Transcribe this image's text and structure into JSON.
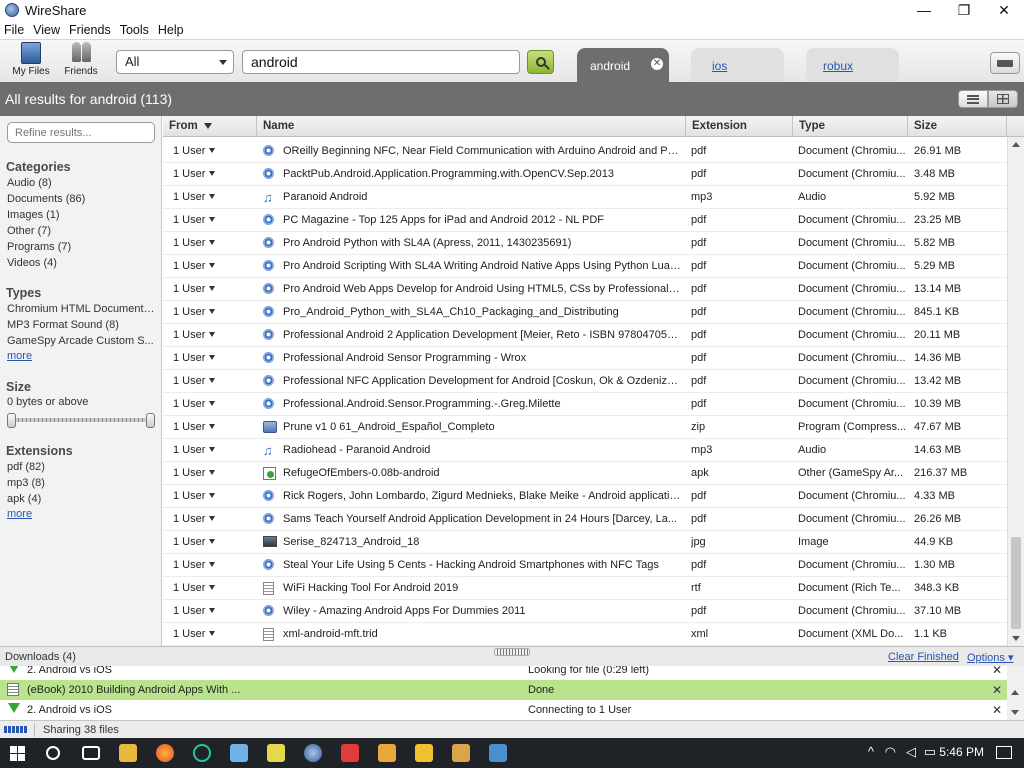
{
  "window": {
    "title": "WireShare",
    "minimize": "—",
    "maximize": "❐",
    "close": "✕"
  },
  "menu": [
    "File",
    "View",
    "Friends",
    "Tools",
    "Help"
  ],
  "toolbar": {
    "my_files_label": "My Files",
    "friends_label": "Friends",
    "filter_value": "All",
    "search_value": "android",
    "tabs": [
      {
        "label": "android",
        "active": true
      },
      {
        "label": "ios",
        "active": false
      },
      {
        "label": "robux",
        "active": false
      }
    ]
  },
  "results": {
    "title": "All results for android (113)"
  },
  "filters": {
    "refine_placeholder": "Refine results...",
    "categories_title": "Categories",
    "categories": [
      "Audio (8)",
      "Documents (86)",
      "Images (1)",
      "Other (7)",
      "Programs (7)",
      "Videos (4)"
    ],
    "types_title": "Types",
    "types": [
      "Chromium HTML Document (...",
      "MP3 Format Sound (8)",
      "GameSpy Arcade Custom S..."
    ],
    "more_label": "more",
    "size_title": "Size",
    "size_range": "0 bytes or above",
    "extensions_title": "Extensions",
    "extensions": [
      "pdf (82)",
      "mp3 (8)",
      "apk (4)"
    ]
  },
  "table": {
    "columns": [
      "From",
      "Name",
      "Extension",
      "Type",
      "Size"
    ],
    "rows": [
      {
        "from": "1 User",
        "icon": "doc",
        "name": "OReilly Beginning NFC, Near Field Communication with Arduino Android and Pho...",
        "ext": "pdf",
        "type": "Document (Chromiu...",
        "size": "26.91 MB"
      },
      {
        "from": "1 User",
        "icon": "doc",
        "name": "PacktPub.Android.Application.Programming.with.OpenCV.Sep.2013",
        "ext": "pdf",
        "type": "Document (Chromiu...",
        "size": "3.48 MB"
      },
      {
        "from": "1 User",
        "icon": "audio",
        "name": "Paranoid Android",
        "ext": "mp3",
        "type": "Audio",
        "size": "5.92 MB"
      },
      {
        "from": "1 User",
        "icon": "doc",
        "name": "PC Magazine - Top 125 Apps for iPad and Android 2012 - NL PDF",
        "ext": "pdf",
        "type": "Document (Chromiu...",
        "size": "23.25 MB"
      },
      {
        "from": "1 User",
        "icon": "doc",
        "name": "Pro Android Python with SL4A (Apress, 2011, 1430235691)",
        "ext": "pdf",
        "type": "Document (Chromiu...",
        "size": "5.82 MB"
      },
      {
        "from": "1 User",
        "icon": "doc",
        "name": "Pro Android Scripting With SL4A Writing Android Native Apps Using Python Lua a...",
        "ext": "pdf",
        "type": "Document (Chromiu...",
        "size": "5.29 MB"
      },
      {
        "from": "1 User",
        "icon": "doc",
        "name": "Pro Android Web Apps Develop for Android Using HTML5, CSs by Professionals...",
        "ext": "pdf",
        "type": "Document (Chromiu...",
        "size": "13.14 MB"
      },
      {
        "from": "1 User",
        "icon": "doc",
        "name": "Pro_Android_Python_with_SL4A_Ch10_Packaging_and_Distributing",
        "ext": "pdf",
        "type": "Document (Chromiu...",
        "size": "845.1 KB"
      },
      {
        "from": "1 User",
        "icon": "doc",
        "name": "Professional Android 2 Application Development [Meier, Reto - ISBN 9780470565...",
        "ext": "pdf",
        "type": "Document (Chromiu...",
        "size": "20.11 MB"
      },
      {
        "from": "1 User",
        "icon": "doc",
        "name": "Professional Android Sensor Programming - Wrox",
        "ext": "pdf",
        "type": "Document (Chromiu...",
        "size": "14.36 MB"
      },
      {
        "from": "1 User",
        "icon": "doc",
        "name": "Professional NFC Application Development for Android [Coskun, Ok & Ozdenizci ...",
        "ext": "pdf",
        "type": "Document (Chromiu...",
        "size": "13.42 MB"
      },
      {
        "from": "1 User",
        "icon": "doc",
        "name": "Professional.Android.Sensor.Programming.-.Greg.Milette",
        "ext": "pdf",
        "type": "Document (Chromiu...",
        "size": "10.39 MB"
      },
      {
        "from": "1 User",
        "icon": "zip",
        "name": "Prune v1 0 61_Android_Español_Completo",
        "ext": "zip",
        "type": "Program (Compress...",
        "size": "47.67 MB"
      },
      {
        "from": "1 User",
        "icon": "audio",
        "name": "Radiohead - Paranoid Android",
        "ext": "mp3",
        "type": "Audio",
        "size": "14.63 MB"
      },
      {
        "from": "1 User",
        "icon": "apk",
        "name": "RefugeOfEmbers-0.08b-android",
        "ext": "apk",
        "type": "Other (GameSpy Ar...",
        "size": "216.37 MB"
      },
      {
        "from": "1 User",
        "icon": "doc",
        "name": "Rick Rogers, John Lombardo, Zigurd Mednieks, Blake Meike - Android application...",
        "ext": "pdf",
        "type": "Document (Chromiu...",
        "size": "4.33 MB"
      },
      {
        "from": "1 User",
        "icon": "doc",
        "name": "Sams Teach Yourself Android Application Development in 24 Hours [Darcey, La...",
        "ext": "pdf",
        "type": "Document (Chromiu...",
        "size": "26.26 MB"
      },
      {
        "from": "1 User",
        "icon": "img",
        "name": "Serise_824713_Android_18",
        "ext": "jpg",
        "type": "Image",
        "size": "44.9 KB"
      },
      {
        "from": "1 User",
        "icon": "doc",
        "name": "Steal Your Life Using 5 Cents - Hacking Android Smartphones with NFC Tags",
        "ext": "pdf",
        "type": "Document (Chromiu...",
        "size": "1.30 MB"
      },
      {
        "from": "1 User",
        "icon": "text",
        "name": "WiFi Hacking Tool For Android 2019",
        "ext": "rtf",
        "type": "Document (Rich Te...",
        "size": "348.3 KB"
      },
      {
        "from": "1 User",
        "icon": "doc",
        "name": "Wiley - Amazing Android Apps For Dummies 2011",
        "ext": "pdf",
        "type": "Document (Chromiu...",
        "size": "37.10 MB"
      },
      {
        "from": "1 User",
        "icon": "text",
        "name": "xml-android-mft.trid",
        "ext": "xml",
        "type": "Document (XML Do...",
        "size": "1.1 KB"
      }
    ]
  },
  "downloads": {
    "title": "Downloads (4)",
    "clear_label": "Clear Finished",
    "options_label": "Options ▾",
    "rows": [
      {
        "icon": "arrow",
        "name": "2. Android vs iOS",
        "status": "Looking for file (0:29 left)",
        "done": false
      },
      {
        "icon": "doc",
        "name": "(eBook) 2010 Building Android Apps With ...",
        "status": "Done",
        "done": true
      },
      {
        "icon": "arrow",
        "name": "2. Android vs iOS",
        "status": "Connecting to 1 User",
        "done": false
      }
    ]
  },
  "status": {
    "text": "Sharing 38 files"
  },
  "taskbar": {
    "time": "5:46 PM"
  },
  "colors": {
    "accent_green": "#b9e48d",
    "header_gray": "#6e6e6e",
    "link_blue": "#2a55b0"
  }
}
